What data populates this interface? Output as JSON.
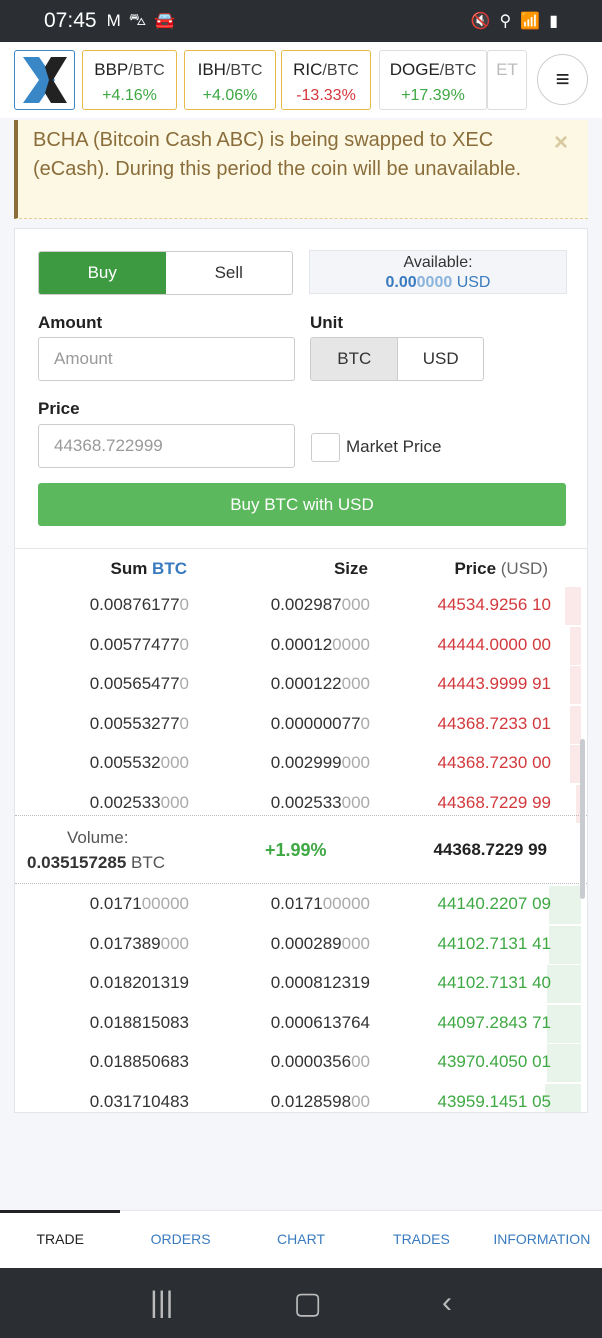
{
  "status_bar": {
    "time": "07:45",
    "icons": [
      "gmail-icon",
      "shopping-bag-icon",
      "car-icon",
      "mute-icon",
      "location-icon",
      "wifi-icon",
      "signal-icon",
      "battery-icon"
    ]
  },
  "header": {
    "tickers": [
      {
        "base": "BBP",
        "quote": "/BTC",
        "change": "+4.16%",
        "trend": "up"
      },
      {
        "base": "IBH",
        "quote": "/BTC",
        "change": "+4.06%",
        "trend": "up"
      },
      {
        "base": "RIC",
        "quote": "/BTC",
        "change": "-13.33%",
        "trend": "down"
      },
      {
        "base": "DOGE",
        "quote": "/BTC",
        "change": "+17.39%",
        "trend": "up"
      },
      {
        "base": "ET",
        "quote": "",
        "change": "",
        "trend": "up"
      }
    ],
    "menu_icon": "hamburger-icon"
  },
  "alert": {
    "text": "BCHA (Bitcoin Cash ABC) is being swapped to XEC (eCash). During this period the coin will be unavailable.",
    "close": "×"
  },
  "form": {
    "buy": "Buy",
    "sell": "Sell",
    "available_label": "Available:",
    "available_main": "0.00",
    "available_faded": "0000",
    "available_unit": " USD",
    "amount_label": "Amount",
    "amount_placeholder": "Amount",
    "unit_label": "Unit",
    "unit_btc": "BTC",
    "unit_usd": "USD",
    "price_label": "Price",
    "price_placeholder": "44368.722999",
    "market_price": "Market Price",
    "submit": "Buy BTC with USD"
  },
  "book": {
    "sum_label": "Sum ",
    "sum_unit": "BTC",
    "size_label": "Size",
    "price_label": "Price",
    "price_unit": " (USD)",
    "asks": [
      {
        "sum": [
          "0.00876177",
          "0"
        ],
        "size": [
          "0.002987",
          "000"
        ],
        "price": [
          "44534.9256",
          "10"
        ],
        "depth": 0.45
      },
      {
        "sum": [
          "0.00577477",
          "0"
        ],
        "size": [
          "0.00012",
          "0000"
        ],
        "price": [
          "44444.0000",
          "00"
        ],
        "depth": 0.3
      },
      {
        "sum": [
          "0.00565477",
          "0"
        ],
        "size": [
          "0.000122",
          "000"
        ],
        "price": [
          "44443.9999",
          "91"
        ],
        "depth": 0.3
      },
      {
        "sum": [
          "0.00553277",
          "0"
        ],
        "size": [
          "0.00000077",
          "0"
        ],
        "price": [
          "44368.7233",
          "01"
        ],
        "depth": 0.3
      },
      {
        "sum": [
          "0.005532",
          "000"
        ],
        "size": [
          "0.002999",
          "000"
        ],
        "price": [
          "44368.7230",
          "00"
        ],
        "depth": 0.3
      },
      {
        "sum": [
          "0.002533",
          "000"
        ],
        "size": [
          "0.002533",
          "000"
        ],
        "price": [
          "44368.7229",
          "99"
        ],
        "depth": 0.15
      }
    ],
    "volume_label": "Volume:",
    "volume_value": "0.035157285",
    "volume_unit": " BTC",
    "change": "+1.99%",
    "last_price": "44368.7229",
    "last_price_tail": "99",
    "bids": [
      {
        "sum": [
          "0.0171",
          "00000"
        ],
        "size": [
          "0.0171",
          "00000"
        ],
        "price": [
          "44140.2207",
          "09"
        ],
        "depth": 0.9
      },
      {
        "sum": [
          "0.017389",
          "000"
        ],
        "size": [
          "0.000289",
          "000"
        ],
        "price": [
          "44102.7131",
          "41"
        ],
        "depth": 0.9
      },
      {
        "sum": [
          "0.018201319",
          ""
        ],
        "size": [
          "0.000812319",
          ""
        ],
        "price": [
          "44102.7131",
          "40"
        ],
        "depth": 0.95
      },
      {
        "sum": [
          "0.018815083",
          ""
        ],
        "size": [
          "0.000613764",
          ""
        ],
        "price": [
          "44097.2843",
          "71"
        ],
        "depth": 0.95
      },
      {
        "sum": [
          "0.018850683",
          ""
        ],
        "size": [
          "0.0000356",
          "00"
        ],
        "price": [
          "43970.4050",
          "01"
        ],
        "depth": 0.95
      },
      {
        "sum": [
          "0.031710483",
          ""
        ],
        "size": [
          "0.0128598",
          "00"
        ],
        "price": [
          "43959.1451",
          "05"
        ],
        "depth": 1.0
      }
    ]
  },
  "nav": [
    "TRADE",
    "ORDERS",
    "CHART",
    "TRADES",
    "INFORMATION"
  ],
  "colors": {
    "buy": "#3d9a41",
    "ask": "#d2383c",
    "bid": "#3ea843",
    "link": "#3a7bbf"
  }
}
